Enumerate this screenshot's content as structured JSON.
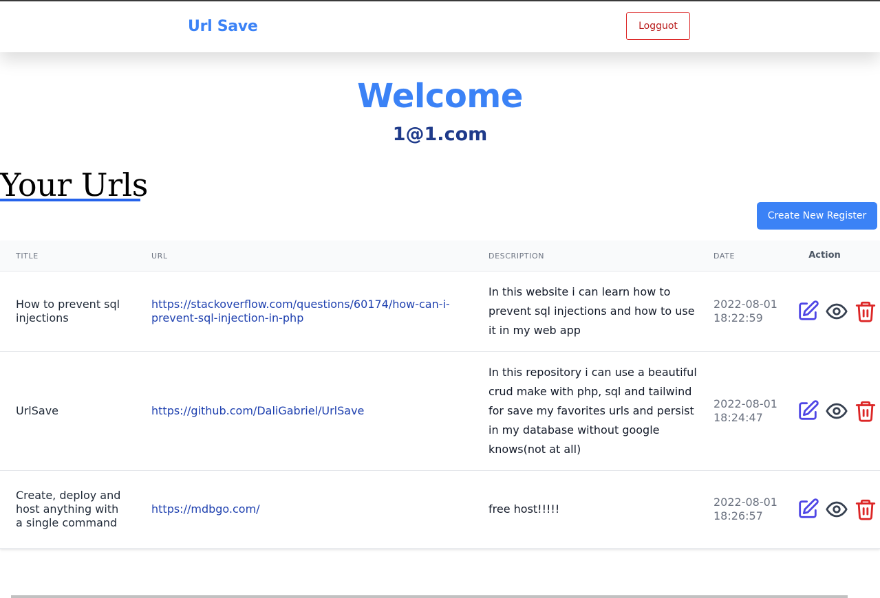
{
  "navbar": {
    "brand": "Url Save",
    "logout_label": "Logguot"
  },
  "hero": {
    "welcome": "Welcome",
    "email": "1@1.com"
  },
  "section": {
    "title": "Your Urls",
    "create_label": "Create New Register"
  },
  "table": {
    "headers": {
      "title": "TITLE",
      "url": "URL",
      "description": "DESCRIPTION",
      "date": "DATE",
      "action": "Action"
    },
    "rows": [
      {
        "title": "How to prevent sql injections",
        "url": "https://stackoverflow.com/questions/60174/how-can-i-prevent-sql-injection-in-php",
        "description": "In this website i can learn how to prevent sql injections and how to use it in my web app",
        "date": "2022-08-01 18:22:59"
      },
      {
        "title": "UrlSave",
        "url": "https://github.com/DaliGabriel/UrlSave",
        "description": "In this repository i can use a beautiful crud make with php, sql and tailwind for save my favorites urls and persist in my database without google knows(not at all)",
        "date": "2022-08-01 18:24:47"
      },
      {
        "title": "Create, deploy and host anything with a single command",
        "url": "https://mdbgo.com/",
        "description": "free host!!!!!",
        "date": "2022-08-01 18:26:57"
      }
    ]
  },
  "icons": {
    "edit": "edit-icon",
    "view": "eye-icon",
    "delete": "trash-icon"
  },
  "colors": {
    "brand": "#3b82f6",
    "email": "#1e3a8a",
    "logout": "#dc2626",
    "link": "#1e40af",
    "edit_icon": "#4f46e5",
    "view_icon": "#374151",
    "delete_icon": "#dc2626"
  }
}
